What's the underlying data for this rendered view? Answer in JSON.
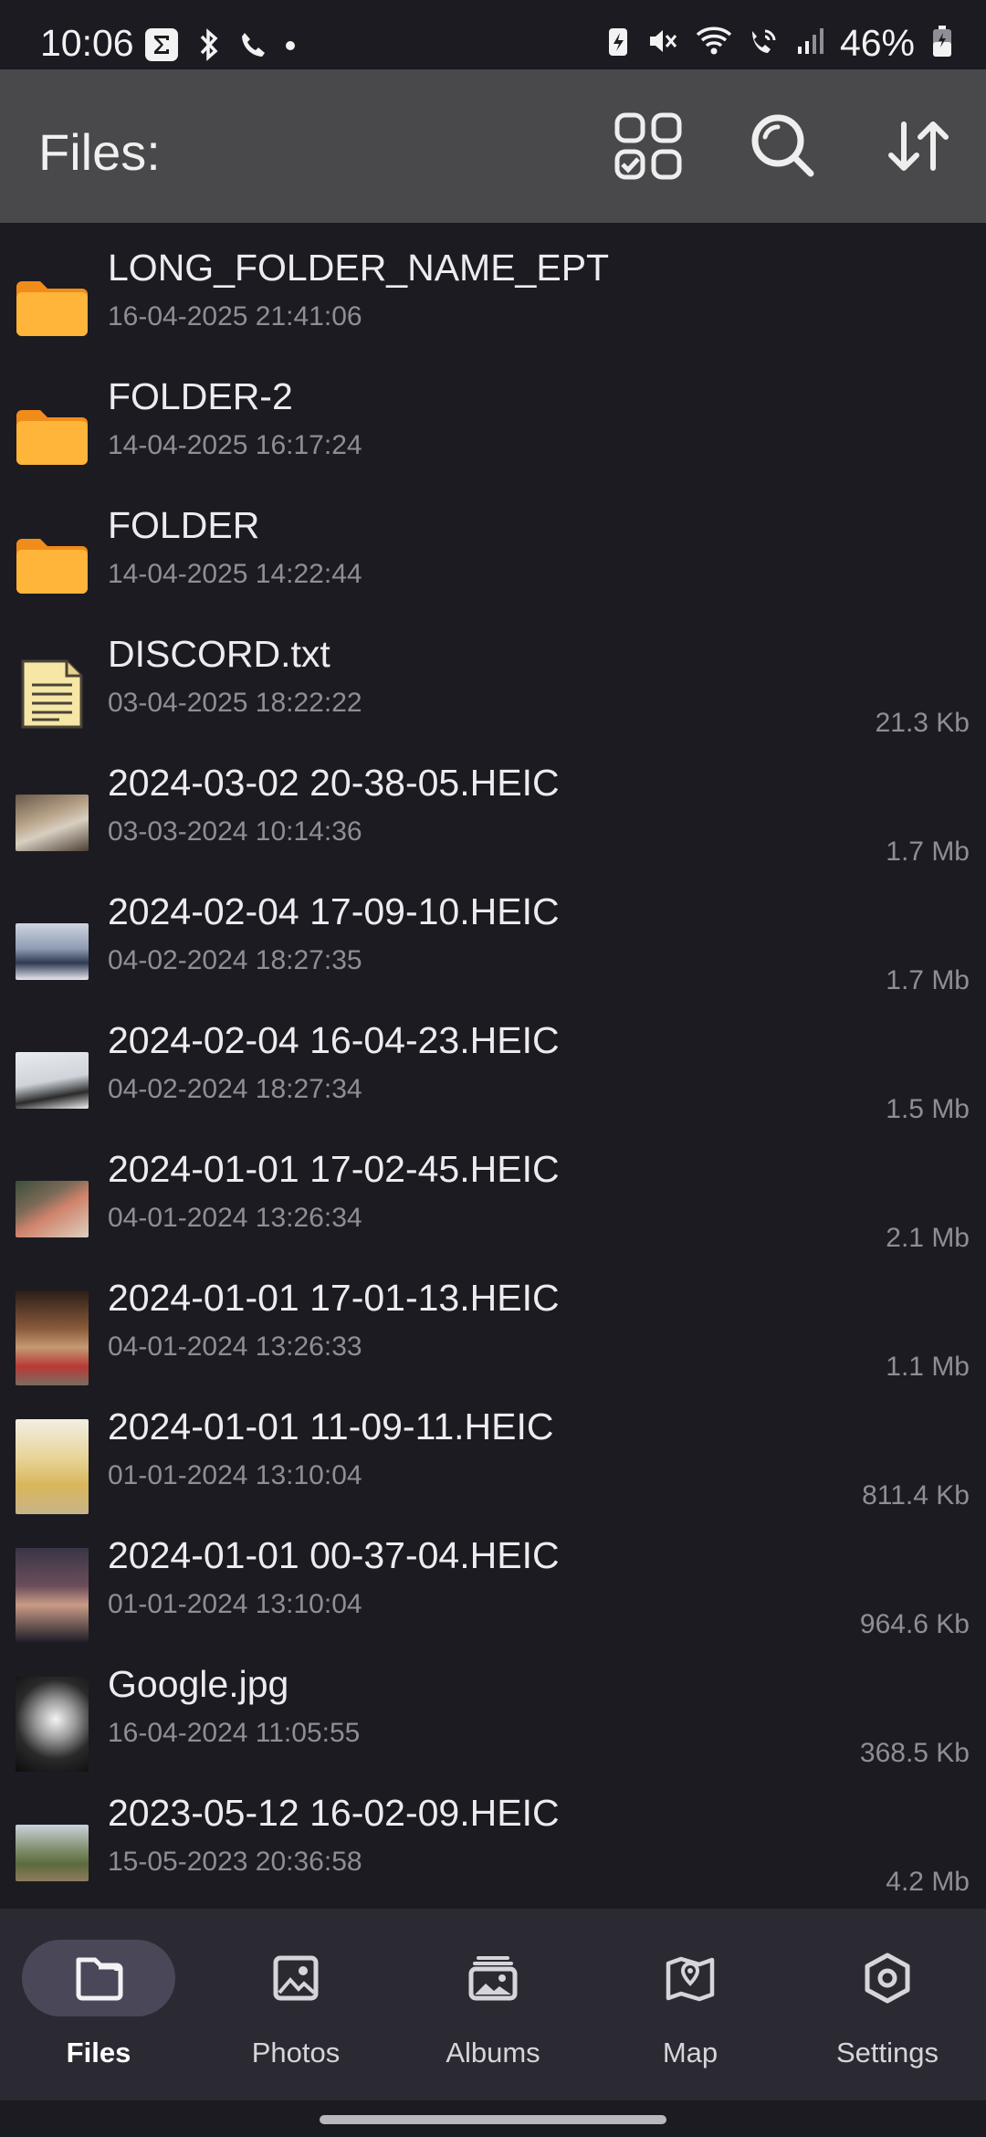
{
  "status_bar": {
    "time": "10:06",
    "battery": "46%"
  },
  "app_bar": {
    "title": "Files:"
  },
  "files": [
    {
      "name": "LONG_FOLDER_NAME_EPT",
      "date": "16-04-2025 21:41:06",
      "size": "",
      "icon": "folder-icon"
    },
    {
      "name": "FOLDER-2",
      "date": "14-04-2025 16:17:24",
      "size": "",
      "icon": "folder-icon"
    },
    {
      "name": "FOLDER",
      "date": "14-04-2025 14:22:44",
      "size": "",
      "icon": "folder-icon"
    },
    {
      "name": "DISCORD.txt",
      "date": "03-04-2025 18:22:22",
      "size": "21.3 Kb",
      "icon": "text-file-icon"
    },
    {
      "name": "2024-03-02 20-38-05.HEIC",
      "date": "03-03-2024 10:14:36",
      "size": "1.7 Mb",
      "icon": "photo-thumbnail"
    },
    {
      "name": "2024-02-04 17-09-10.HEIC",
      "date": "04-02-2024 18:27:35",
      "size": "1.7 Mb",
      "icon": "photo-thumbnail"
    },
    {
      "name": "2024-02-04 16-04-23.HEIC",
      "date": "04-02-2024 18:27:34",
      "size": "1.5 Mb",
      "icon": "photo-thumbnail"
    },
    {
      "name": "2024-01-01 17-02-45.HEIC",
      "date": "04-01-2024 13:26:34",
      "size": "2.1 Mb",
      "icon": "photo-thumbnail"
    },
    {
      "name": "2024-01-01 17-01-13.HEIC",
      "date": "04-01-2024 13:26:33",
      "size": "1.1 Mb",
      "icon": "photo-thumbnail"
    },
    {
      "name": "2024-01-01 11-09-11.HEIC",
      "date": "01-01-2024 13:10:04",
      "size": "811.4 Kb",
      "icon": "photo-thumbnail"
    },
    {
      "name": "2024-01-01 00-37-04.HEIC",
      "date": "01-01-2024 13:10:04",
      "size": "964.6 Kb",
      "icon": "photo-thumbnail"
    },
    {
      "name": "Google.jpg",
      "date": "16-04-2024 11:05:55",
      "size": "368.5 Kb",
      "icon": "photo-thumbnail"
    },
    {
      "name": "2023-05-12 16-02-09.HEIC",
      "date": "15-05-2023 20:36:58",
      "size": "4.2 Mb",
      "icon": "photo-thumbnail"
    }
  ],
  "bottom_nav": [
    {
      "label": "Files",
      "icon": "files-icon",
      "active": true
    },
    {
      "label": "Photos",
      "icon": "photos-icon",
      "active": false
    },
    {
      "label": "Albums",
      "icon": "albums-icon",
      "active": false
    },
    {
      "label": "Map",
      "icon": "map-icon",
      "active": false
    },
    {
      "label": "Settings",
      "icon": "settings-icon",
      "active": false
    }
  ],
  "colors": {
    "background": "#1c1b21",
    "app_bar": "#49494c",
    "bottom_nav": "#2b2a33",
    "folder": "#f5a623",
    "active_pill": "#4a4759"
  }
}
